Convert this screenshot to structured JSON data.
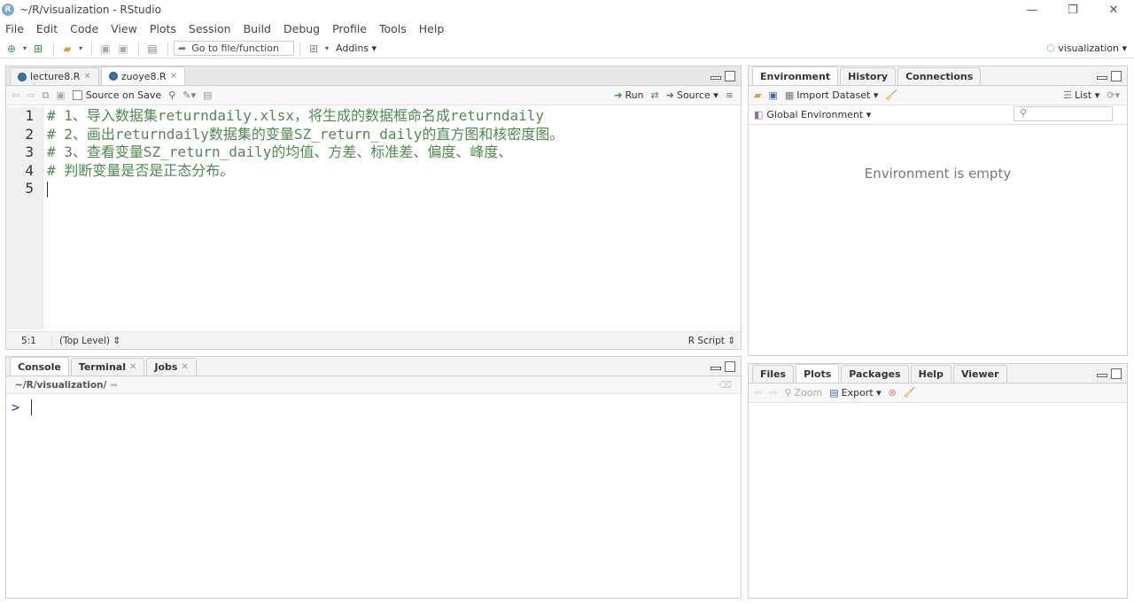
{
  "window": {
    "app_icon": "R",
    "title": "~/R/visualization - RStudio"
  },
  "menu": [
    "File",
    "Edit",
    "Code",
    "View",
    "Plots",
    "Session",
    "Build",
    "Debug",
    "Profile",
    "Tools",
    "Help"
  ],
  "toolbar": {
    "goto_label": "Go to file/function",
    "addins_label": "Addins",
    "project_label": "visualization"
  },
  "editor": {
    "tabs": [
      {
        "label": "lecture8.R",
        "active": false
      },
      {
        "label": "zuoye8.R",
        "active": true
      }
    ],
    "source_on_save_label": "Source on Save",
    "run_label": "Run",
    "source_label": "Source",
    "line_numbers": [
      "1",
      "2",
      "3",
      "4",
      "5"
    ],
    "lines": [
      "# 1、导入数据集returndaily.xlsx，将生成的数据框命名成returndaily",
      "# 2、画出returndaily数据集的变量SZ_return_daily的直方图和核密度图。",
      "# 3、查看变量SZ_return_daily的均值、方差、标准差、偏度、峰度、",
      "# 判断变量是否是正态分布。",
      ""
    ],
    "status_pos": "5:1",
    "status_level": "(Top Level)",
    "status_filetype": "R Script"
  },
  "console": {
    "tabs": [
      {
        "label": "Console",
        "active": true
      },
      {
        "label": "Terminal",
        "active": false
      },
      {
        "label": "Jobs",
        "active": false
      }
    ],
    "path": "~/R/visualization/",
    "prompt": ">"
  },
  "environment": {
    "tabs": [
      {
        "label": "Environment",
        "active": true
      },
      {
        "label": "History",
        "active": false
      },
      {
        "label": "Connections",
        "active": false
      }
    ],
    "import_label": "Import Dataset",
    "list_label": "List",
    "scope_label": "Global Environment",
    "empty_message": "Environment is empty"
  },
  "files": {
    "tabs": [
      {
        "label": "Files",
        "active": false
      },
      {
        "label": "Plots",
        "active": true
      },
      {
        "label": "Packages",
        "active": false
      },
      {
        "label": "Help",
        "active": false
      },
      {
        "label": "Viewer",
        "active": false
      }
    ],
    "zoom_label": "Zoom",
    "export_label": "Export"
  }
}
